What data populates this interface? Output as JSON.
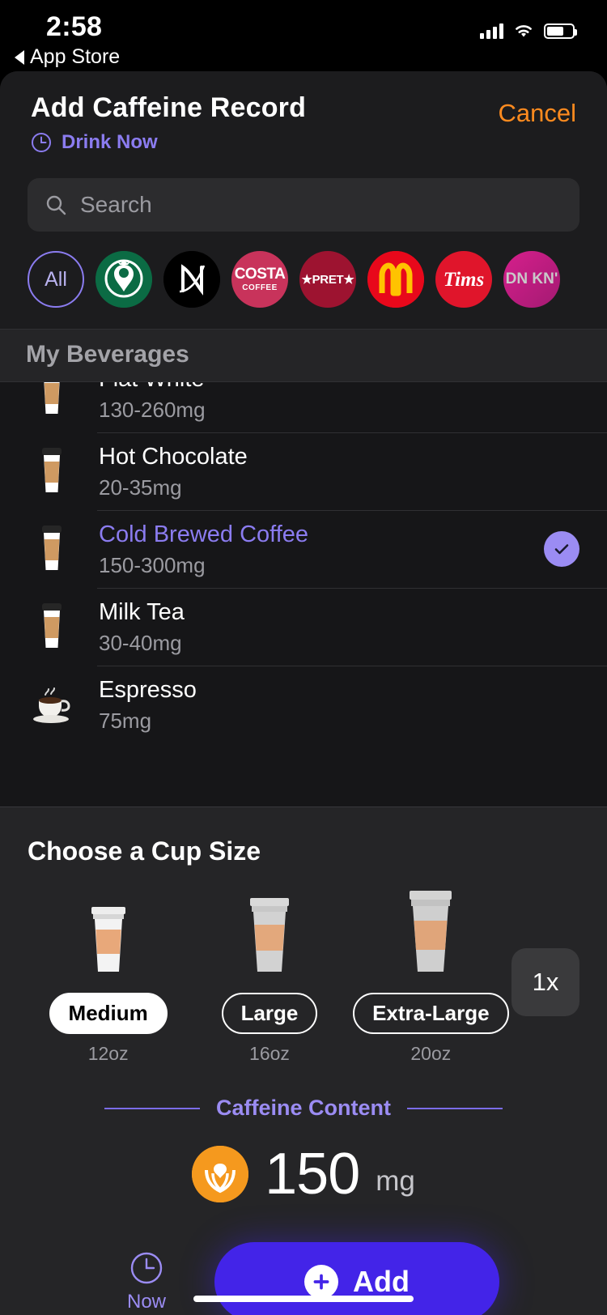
{
  "status_bar": {
    "time": "2:58",
    "back_label": "App Store",
    "icons": [
      "signal-icon",
      "wifi-icon",
      "battery-icon"
    ]
  },
  "header": {
    "title": "Add Caffeine Record",
    "subtitle": "Drink Now",
    "cancel_label": "Cancel",
    "accent_purple": "#8b7cf0",
    "cancel_color": "#ff8b1f"
  },
  "search": {
    "placeholder": "Search",
    "value": ""
  },
  "brands": [
    {
      "id": "all",
      "label": "All"
    },
    {
      "id": "starbucks",
      "label": "Starbucks"
    },
    {
      "id": "nespresso",
      "label": "N"
    },
    {
      "id": "costa",
      "label": "COSTA",
      "sub": "COFFEE"
    },
    {
      "id": "pret",
      "label": "★PRET★"
    },
    {
      "id": "mcdonalds",
      "label": "M"
    },
    {
      "id": "tims",
      "label": "Tims"
    },
    {
      "id": "dunkin",
      "label": "DN KN'"
    }
  ],
  "my_beverages": {
    "section_title": "My Beverages",
    "items": [
      {
        "name": "Flat White",
        "caffeine": "130-260mg",
        "icon": "paper-cup-icon",
        "selected": false
      },
      {
        "name": "Hot Chocolate",
        "caffeine": "20-35mg",
        "icon": "paper-cup-icon",
        "selected": false
      },
      {
        "name": "Cold Brewed Coffee",
        "caffeine": "150-300mg",
        "icon": "paper-cup-icon",
        "selected": true
      },
      {
        "name": "Milk Tea",
        "caffeine": "30-40mg",
        "icon": "paper-cup-icon",
        "selected": false
      },
      {
        "name": "Espresso",
        "caffeine": "75mg",
        "icon": "espresso-cup-icon",
        "selected": false
      }
    ]
  },
  "cup_size": {
    "title": "Choose a Cup Size",
    "multiplier": "1x",
    "options": [
      {
        "label": "Medium",
        "volume": "12oz",
        "selected": true
      },
      {
        "label": "Large",
        "volume": "16oz",
        "selected": false
      },
      {
        "label": "Extra-Large",
        "volume": "20oz",
        "selected": false
      }
    ]
  },
  "caffeine": {
    "divider_label": "Caffeine Content",
    "amount": "150",
    "unit": "mg",
    "badge_color": "#f5991e"
  },
  "actions": {
    "now_label": "Now",
    "add_label": "Add",
    "add_color": "#4324e8"
  }
}
